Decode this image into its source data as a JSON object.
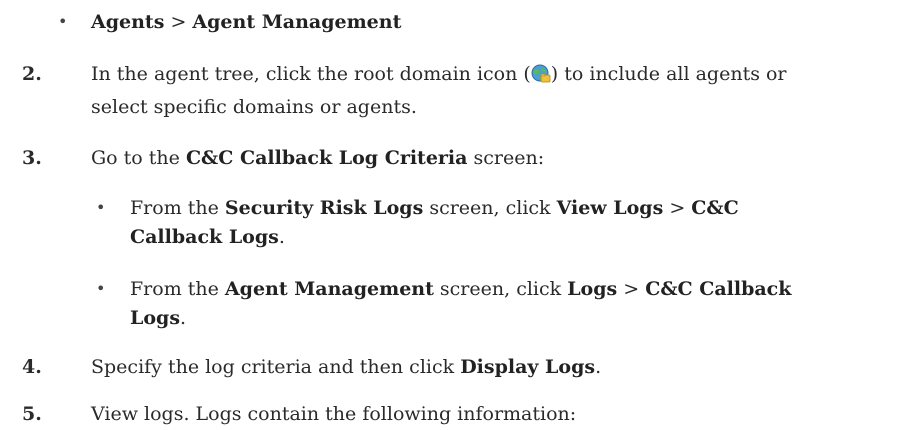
{
  "top_bullet": {
    "part1": "Agents",
    "sep": " > ",
    "part2": "Agent Management"
  },
  "step2": {
    "number": "2.",
    "line1_before": "In the agent tree, click the root domain icon (",
    "line1_after": ") to include all agents or",
    "line2": "select specific domains or agents."
  },
  "step3": {
    "number": "3.",
    "before": "Go to the ",
    "bold": "C&C Callback Log Criteria",
    "after": " screen:",
    "sub1": {
      "t1": "From the ",
      "b1": "Security Risk Logs",
      "t2": " screen, click ",
      "b2": "View Logs",
      "t3": " > ",
      "b3": "C&C",
      "line2_bold": "Callback Logs",
      "line2_end": "."
    },
    "sub2": {
      "t1": "From the ",
      "b1": "Agent Management",
      "t2": " screen, click ",
      "b2": "Logs",
      "t3": " > ",
      "b3": "C&C Callback",
      "line2_bold": "Logs",
      "line2_end": "."
    }
  },
  "step4": {
    "number": "4.",
    "before": "Specify the log criteria and then click ",
    "bold": "Display Logs",
    "after": "."
  },
  "step5": {
    "number": "5.",
    "text": "View logs. Logs contain the following information:"
  },
  "bullet_glyph": "•",
  "icons": {
    "root_domain": "globe-folder-icon"
  }
}
